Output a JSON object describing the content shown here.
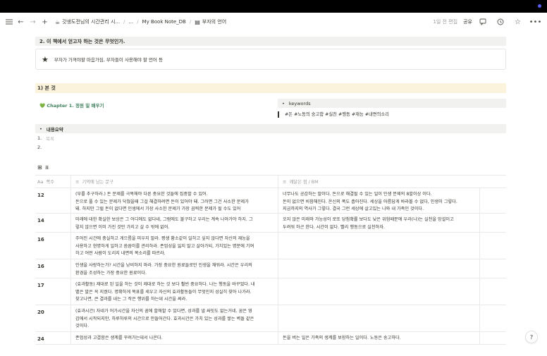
{
  "topbar": {
    "breadcrumbs": [
      {
        "icon": "mug-icon",
        "label": "갓생도전님의 시간관리 시..."
      },
      {
        "icon": "",
        "label": "..."
      },
      {
        "icon": "",
        "label": "My Book Note_DB"
      },
      {
        "icon": "book-icon",
        "label": "부자의 언어"
      }
    ],
    "edited": "1일 전 편집",
    "share": "공유"
  },
  "callout": {
    "heading": "2.  이 책에서 얻고자 하는 것은 무엇인가.",
    "text": "부자가 가져야할 마음가짐, 부자들이 사용해야 할 언어 등"
  },
  "section": {
    "heading": "1) 본 것"
  },
  "chapter": {
    "label": "💚 Chapter 1. 정원 밑 배우기"
  },
  "keywords": {
    "heading": "keywords",
    "text": "#돈 #노동의 숭고함 #실천 #행동 #재능 #내면의소리"
  },
  "summary": {
    "heading": "내용요약",
    "items": [
      {
        "num": "1.",
        "text": "목록"
      },
      {
        "num": "2.",
        "text": ""
      }
    ]
  },
  "database": {
    "title": "표",
    "columns": [
      "쪽수",
      "기억에 남는 문구",
      "깨달은 점 / BM"
    ],
    "rows": [
      {
        "page": "12",
        "quote": "(부를 추구하라.) 돈 문제를 극복해야 다른 중요한 것들에 집중할 수 있어.\n돈으로 풀 수 있는 문제가 닥쳤을때 그걸 해결하려면 돈이 있어야 돼. 그러면 그건 사소한 문제가\n돼. 하지만 그럴 돈이 없다면 인생에서 가장 사소한 문제가 가장 끔찍한 문제가 될 수도 있어",
        "insight": "너무나도 공감하는 말이다. 돈으로 해결될 수 있는 일이 인생 문제의 8할이상 이다.\n돈이 없으면 비참해진다. 온신의 폭도 좁아진다. 세상을 아름답게 바라볼 수 없다, 인생이 그렇다.\n지금까지의 역사가 그렇다. 결국 그런 세상에 살고있는 나와 내 가족인 것이다."
      },
      {
        "page": "14",
        "quote": "미래에 대한 확실한 보상은 그 어디에도 없다네, 그럼에도 불구하고 우리는 계속 나아가야 하지. 그\n렇지 않으면 이미 가진 것만 가지고 살 수 밖에 없어.",
        "insight": "오지 않은 미래와 가능성이 로또 당첨확률 보다도 낮은 위험때문에 우리(나)는 실천을 망설이고\n두려워 하곤 한다. 시간이 없다. 빨리 행동으로 실천하자."
      },
      {
        "page": "16",
        "quote": "주어진 시간에 충실하고 게으름을 피우지 말라. 평생 황소같이 일하고 싶지 않다면 자신의 재능을\n사용하고 현명하게 일하고 씀씀이를 관리하라. 존엄성을 잃지 말고 살아가되, 가치있는 명분에 기여\n하고 어떤 사람이 도리지 내면의 목소리를 따르라.",
        "insight": ""
      },
      {
        "page": "16",
        "quote": "인생을 사랑하는가? 시간을 낭비하지 마라. 가장 중요한 원료들로만 인생을 채워라. 시간은 우리의\n환경을 조성하는 가장 중요한 원료이다.",
        "insight": ""
      },
      {
        "page": "17",
        "quote": "(효과활동) 제대로 된 일을 하는 것이 제대로 하는 것 보다 훨씬 중요하다. 나는 행동을 바꾸었다. 내\n뱉은 말은 꼭 지켰다. 명확하게 목표를 세우고 자신의 효과활동들이 무엇인지 성실히 찾아 나가라.\n찾고나면, 큰 결과를 내는 그 작은 행위를 하는데 시간을 써라.",
        "insight": ""
      },
      {
        "page": "20",
        "quote": "(효과시간) 자네가 어가시간을 자신의 꿈에 할애할 수 있다면, 성과를 낼 싸잇도 없는거네. 꿈은 영\n감에서 시작되지만, 하루하루의 시간으로 만들어간다. 효과시간은 가치 있는 성과를 쌓는 벽돌 같은\n것이다.",
        "insight": ""
      },
      {
        "page": "24",
        "quote": "존엄성과 고결함은 생계를 꾸려가는데서 나온다.",
        "insight": "돈을 버는 일은 가족의 생계를 보장하는 일이다. 노동은 숭고하다."
      }
    ]
  },
  "help": "?"
}
